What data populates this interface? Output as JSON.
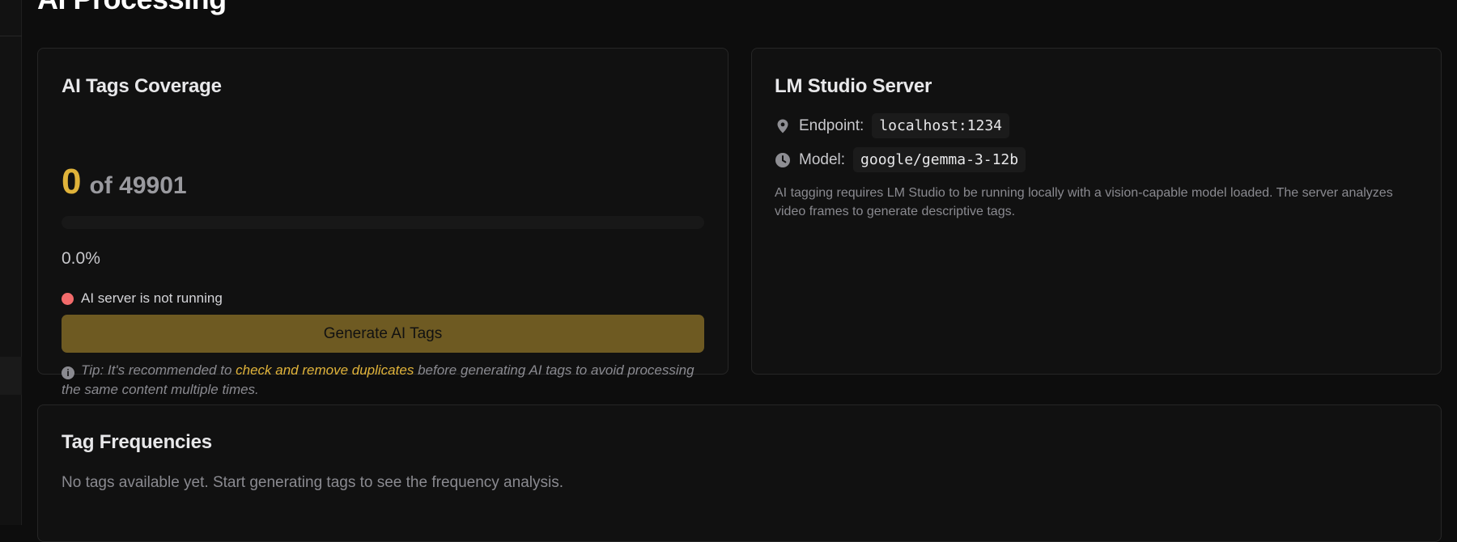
{
  "page": {
    "title": "AI Processing"
  },
  "coverage": {
    "title": "AI Tags Coverage",
    "tagged": "0",
    "of_total": "of 49901",
    "progress_fraction": 0.0,
    "percent_label": "0.0%",
    "status_text": "AI server is not running",
    "status_color": "#f26b6b",
    "generate_label": "Generate AI Tags",
    "tip": {
      "prefix": "Tip: It's recommended to",
      "link": "check and remove duplicates",
      "suffix": "before generating AI tags to avoid processing the same content multiple times."
    }
  },
  "server": {
    "title": "LM Studio Server",
    "endpoint_key": "Endpoint:",
    "endpoint_value": "localhost:1234",
    "endpoint_icon": "location-pin-icon",
    "model_key": "Model:",
    "model_value": "google/gemma-3-12b",
    "model_icon": "clock-icon",
    "description": "AI tagging requires LM Studio to be running locally with a vision-capable model loaded. The server analyzes video frames to generate descriptive tags."
  },
  "frequencies": {
    "title": "Tag Frequencies",
    "empty_text": "No tags available yet. Start generating tags to see the frequency analysis."
  },
  "colors": {
    "accent": "#e0b33a",
    "button_bg": "#6e5a22",
    "background": "#0d0d0d",
    "card_bg": "#111111"
  }
}
